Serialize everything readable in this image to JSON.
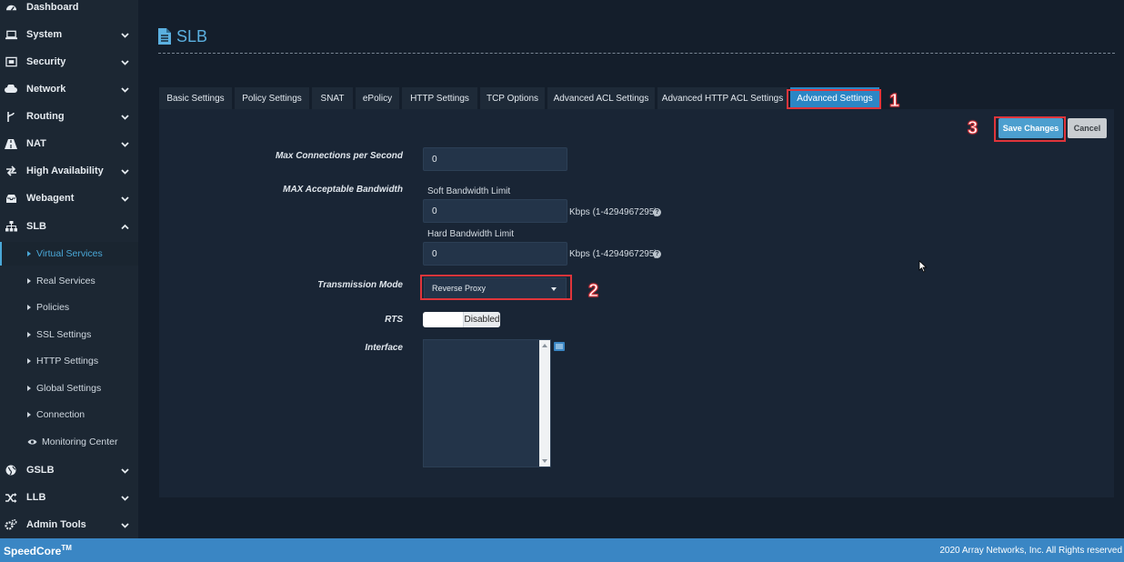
{
  "sidebar": {
    "items": [
      {
        "label": "Dashboard",
        "icon": "dashboard-icon"
      },
      {
        "label": "System",
        "icon": "laptop-icon"
      },
      {
        "label": "Security",
        "icon": "security-icon"
      },
      {
        "label": "Network",
        "icon": "cloud-icon"
      },
      {
        "label": "Routing",
        "icon": "routing-icon"
      },
      {
        "label": "NAT",
        "icon": "road-icon"
      },
      {
        "label": "High Availability",
        "icon": "exchange-icon"
      },
      {
        "label": "Webagent",
        "icon": "inbox-icon"
      },
      {
        "label": "SLB",
        "icon": "sitemap-icon"
      },
      {
        "label": "GSLB",
        "icon": "globe-icon"
      },
      {
        "label": "LLB",
        "icon": "shuffle-icon"
      },
      {
        "label": "Admin Tools",
        "icon": "cogs-icon"
      }
    ],
    "slb_subitems": [
      {
        "label": "Virtual Services",
        "active": true
      },
      {
        "label": "Real Services"
      },
      {
        "label": "Policies"
      },
      {
        "label": "SSL Settings"
      },
      {
        "label": "HTTP Settings"
      },
      {
        "label": "Global Settings"
      },
      {
        "label": "Connection"
      },
      {
        "label": "Monitoring Center",
        "icon": "eye-icon"
      }
    ]
  },
  "header": {
    "title": "SLB"
  },
  "tabs": [
    {
      "label": "Basic Settings"
    },
    {
      "label": "Policy Settings"
    },
    {
      "label": "SNAT"
    },
    {
      "label": "ePolicy"
    },
    {
      "label": "HTTP Settings"
    },
    {
      "label": "TCP Options"
    },
    {
      "label": "Advanced ACL Settings"
    },
    {
      "label": "Advanced HTTP ACL Settings"
    },
    {
      "label": "Advanced Settings",
      "active": true
    }
  ],
  "form": {
    "max_conn_label": "Max Connections per Second",
    "max_conn_value": "0",
    "bandwidth_label": "MAX Acceptable Bandwidth",
    "soft_label": "Soft Bandwidth Limit",
    "soft_value": "0",
    "soft_unit": "Kbps (1-4294967295)",
    "hard_label": "Hard Bandwidth Limit",
    "hard_value": "0",
    "hard_unit": "Kbps (1-4294967295)",
    "transmission_label": "Transmission Mode",
    "transmission_value": "Reverse Proxy",
    "rts_label": "RTS",
    "rts_value": "Disabled",
    "interface_label": "Interface",
    "help_glyph": "?"
  },
  "actions": {
    "save_label": "Save Changes",
    "cancel_label": "Cancel"
  },
  "annotations": {
    "step1": "1",
    "step2": "2",
    "step3": "3"
  },
  "footer": {
    "brand": "SpeedCore",
    "brand_mark": "TM",
    "copyright": "2020 Array Networks, Inc. All Rights reserved"
  },
  "colors": {
    "accent": "#2b86c5",
    "highlight": "#e0353b",
    "footer": "#3a86c4"
  }
}
